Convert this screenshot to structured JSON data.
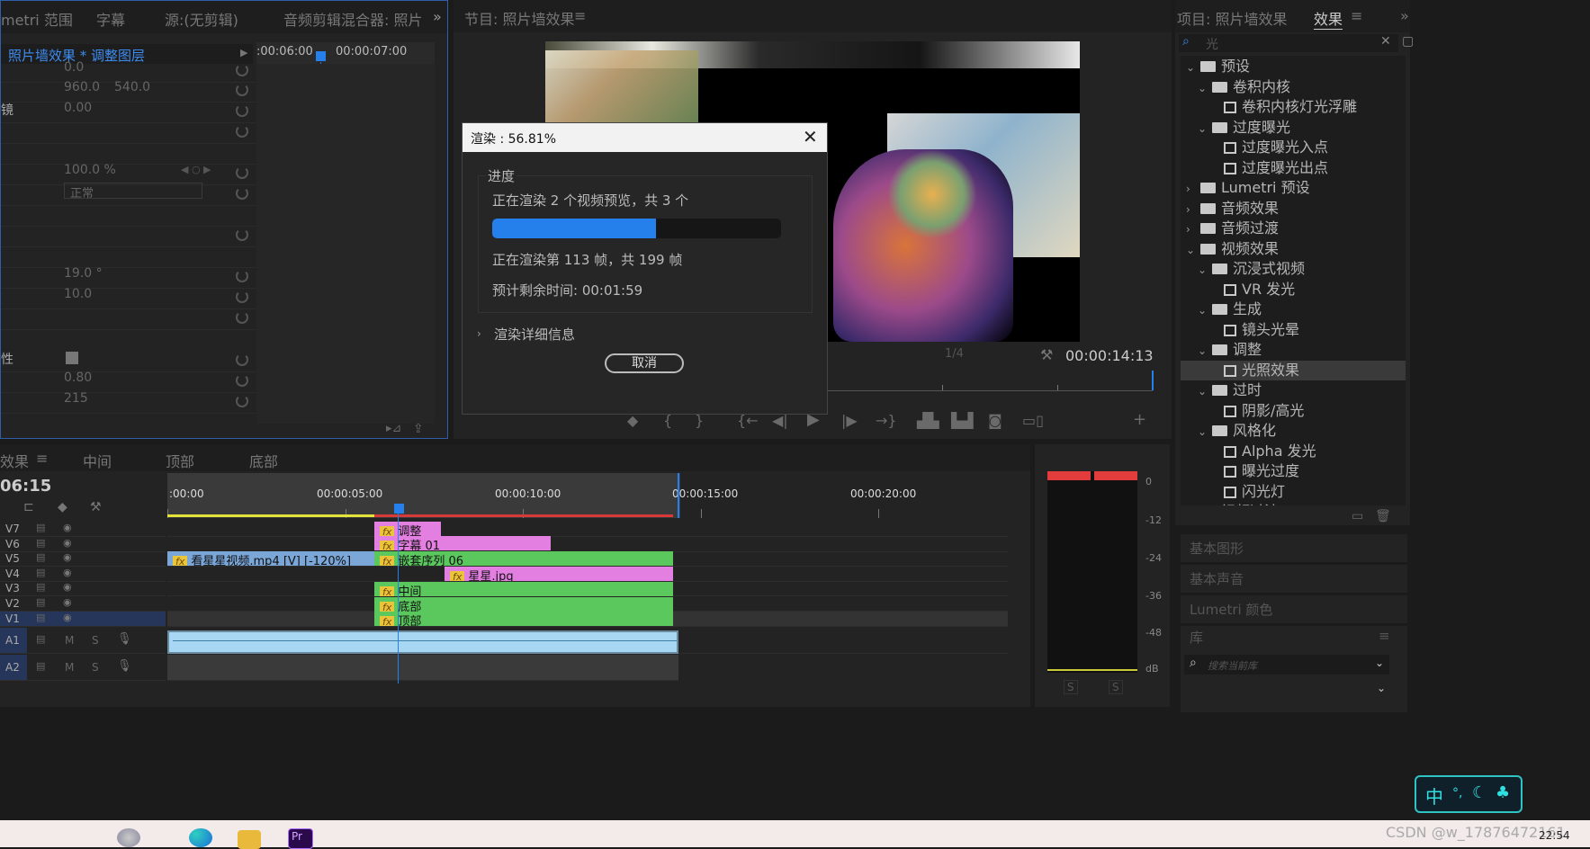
{
  "left_panel": {
    "tabs": [
      "metri 范围",
      "字幕",
      "源:(无剪辑)",
      "音频剪辑混合器: 照片"
    ],
    "more": "»",
    "clip_title": "照片墙效果 * 调整图层",
    "timecodes": [
      ":00:06:00",
      "00:00:07:00"
    ],
    "rows": [
      {
        "label": "",
        "v1": "0.0",
        "v2": ""
      },
      {
        "label": "",
        "v1": "960.0",
        "v2": "540.0"
      },
      {
        "label": "镜",
        "v1": "0.00",
        "v2": ""
      },
      {
        "label": "",
        "v1": "",
        "v2": ""
      },
      {
        "label": "",
        "v1": "",
        "v2": ""
      },
      {
        "label": "",
        "v1": "100.0 %",
        "v2": ""
      },
      {
        "label": "",
        "v1": "正常",
        "v2": ""
      },
      {
        "label": "",
        "v1": "",
        "v2": ""
      },
      {
        "label": "",
        "v1": "",
        "v2": ""
      },
      {
        "label": "",
        "v1": "",
        "v2": ""
      },
      {
        "label": "",
        "v1": "19.0 °",
        "v2": ""
      },
      {
        "label": "",
        "v1": "10.0",
        "v2": ""
      },
      {
        "label": "",
        "v1": "",
        "v2": ""
      },
      {
        "label": "性",
        "v1": "",
        "v2": ""
      },
      {
        "label": "",
        "v1": "0.80",
        "v2": ""
      },
      {
        "label": "",
        "v1": "215",
        "v2": ""
      },
      {
        "label": "",
        "v1": "",
        "v2": ""
      }
    ]
  },
  "program": {
    "title": "节目: 照片墙效果",
    "zoom": "1/4",
    "timecode": "00:00:14:13"
  },
  "render_dialog": {
    "title": "渲染 : 56.81%",
    "group_label": "进度",
    "line1": "正在渲染 2 个视频预览，共 3 个",
    "progress": 0.5681,
    "line2": "正在渲染第 113 帧，共 199 帧",
    "line3": "预计剩余时间: 00:01:59",
    "details": "渲染详细信息",
    "cancel": "取消"
  },
  "project_panel": {
    "tabs": [
      "项目: 照片墙效果",
      "效果"
    ],
    "search_value": "光",
    "tree": [
      {
        "depth": 0,
        "chev": "v",
        "icon": "folder-star",
        "label": "预设"
      },
      {
        "depth": 1,
        "chev": "v",
        "icon": "folder-star",
        "label": "卷积内核"
      },
      {
        "depth": 2,
        "chev": "",
        "icon": "preset",
        "label": "卷积内核灯光浮雕"
      },
      {
        "depth": 1,
        "chev": "v",
        "icon": "folder-star",
        "label": "过度曝光"
      },
      {
        "depth": 2,
        "chev": "",
        "icon": "preset",
        "label": "过度曝光入点"
      },
      {
        "depth": 2,
        "chev": "",
        "icon": "preset",
        "label": "过度曝光出点"
      },
      {
        "depth": 0,
        "chev": ">",
        "icon": "folder-star",
        "label": "Lumetri 预设"
      },
      {
        "depth": 0,
        "chev": ">",
        "icon": "folder",
        "label": "音频效果"
      },
      {
        "depth": 0,
        "chev": ">",
        "icon": "folder",
        "label": "音频过渡"
      },
      {
        "depth": 0,
        "chev": "v",
        "icon": "folder",
        "label": "视频效果"
      },
      {
        "depth": 1,
        "chev": "v",
        "icon": "folder",
        "label": "沉浸式视频"
      },
      {
        "depth": 2,
        "chev": "",
        "icon": "effect",
        "label": "VR 发光"
      },
      {
        "depth": 1,
        "chev": "v",
        "icon": "folder",
        "label": "生成"
      },
      {
        "depth": 2,
        "chev": "",
        "icon": "effect",
        "label": "镜头光晕"
      },
      {
        "depth": 1,
        "chev": "v",
        "icon": "folder",
        "label": "调整"
      },
      {
        "depth": 2,
        "chev": "",
        "icon": "effect",
        "label": "光照效果",
        "selected": true
      },
      {
        "depth": 1,
        "chev": "v",
        "icon": "folder",
        "label": "过时"
      },
      {
        "depth": 2,
        "chev": "",
        "icon": "effect",
        "label": "阴影/高光"
      },
      {
        "depth": 1,
        "chev": "v",
        "icon": "folder",
        "label": "风格化"
      },
      {
        "depth": 2,
        "chev": "",
        "icon": "effect",
        "label": "Alpha 发光"
      },
      {
        "depth": 2,
        "chev": "",
        "icon": "effect",
        "label": "曝光过度"
      },
      {
        "depth": 2,
        "chev": "",
        "icon": "effect",
        "label": "闪光灯"
      },
      {
        "depth": 0,
        "chev": "v",
        "icon": "folder",
        "label": "视频过渡"
      }
    ],
    "sections": [
      "基本图形",
      "基本声音",
      "Lumetri 颜色",
      "库"
    ],
    "library_placeholder": "搜索当前库"
  },
  "timeline": {
    "tabs": [
      "效果",
      "中间",
      "顶部",
      "底部"
    ],
    "current_time": "06:15",
    "ruler_labels": [
      ":00:00",
      "00:00:05:00",
      "00:00:10:00",
      "00:00:15:00",
      "00:00:20:00"
    ],
    "video_tracks": [
      "V7",
      "V6",
      "V5",
      "V4",
      "V3",
      "V2",
      "V1"
    ],
    "audio_tracks": [
      "A1",
      "A2"
    ],
    "audio_buttons": [
      "M",
      "S"
    ],
    "clips": {
      "adjust": "调整",
      "caption": "字幕 01",
      "video": "看星星视频.mp4 [V] [-120%]",
      "nested": "嵌套序列 06",
      "star": "星星.jpg",
      "middle": "中间",
      "bottom": "底部",
      "top": "顶部"
    }
  },
  "meter": {
    "scale": [
      "0",
      "-12",
      "-24",
      "-36",
      "-48",
      "dB"
    ],
    "solo": [
      "S",
      "S"
    ]
  },
  "taskbar": {
    "ime": "中",
    "time": "22:54",
    "watermark": "CSDN @w_17876472161"
  },
  "colors": {
    "accent_blue": "#2680eb",
    "clip_green": "#5bc85e",
    "clip_pink": "#e37fe0",
    "clip_blue": "#7aa6d8",
    "audio_blue": "#a7d7f3"
  }
}
